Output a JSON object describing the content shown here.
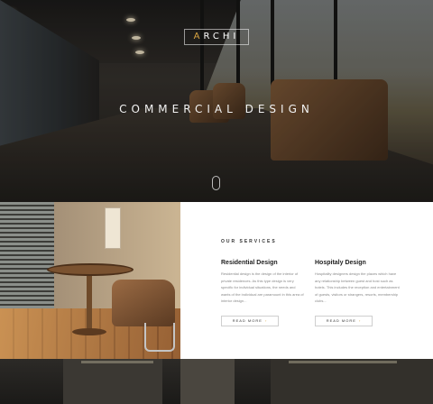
{
  "hero": {
    "logo_first": "A",
    "logo_rest": "RCHI",
    "title": "COMMERCIAL DESIGN"
  },
  "services": {
    "heading": "OUR SERVICES",
    "items": [
      {
        "title": "Residential Design",
        "description": "Residential design is the design of the interior of private residences. As this type design is very specific for individual situations, the needs and wants of the individual are paramount in this area of interior design...",
        "button": "READ MORE"
      },
      {
        "title": "Hospitaly Design",
        "description": "Hospitality designers design the places which have any relationship between guest and host such as hotels. This includes the reception and entertainment of guests, visitors or strangers, resorts, membership clubs...",
        "button": "READ MORE"
      }
    ]
  },
  "colors": {
    "accent": "#d9a441",
    "text_dark": "#222222",
    "text_muted": "#8a8a8a"
  },
  "icons": {
    "scroll": "mouse-scroll-icon",
    "arrow": "chevron-right-icon"
  }
}
